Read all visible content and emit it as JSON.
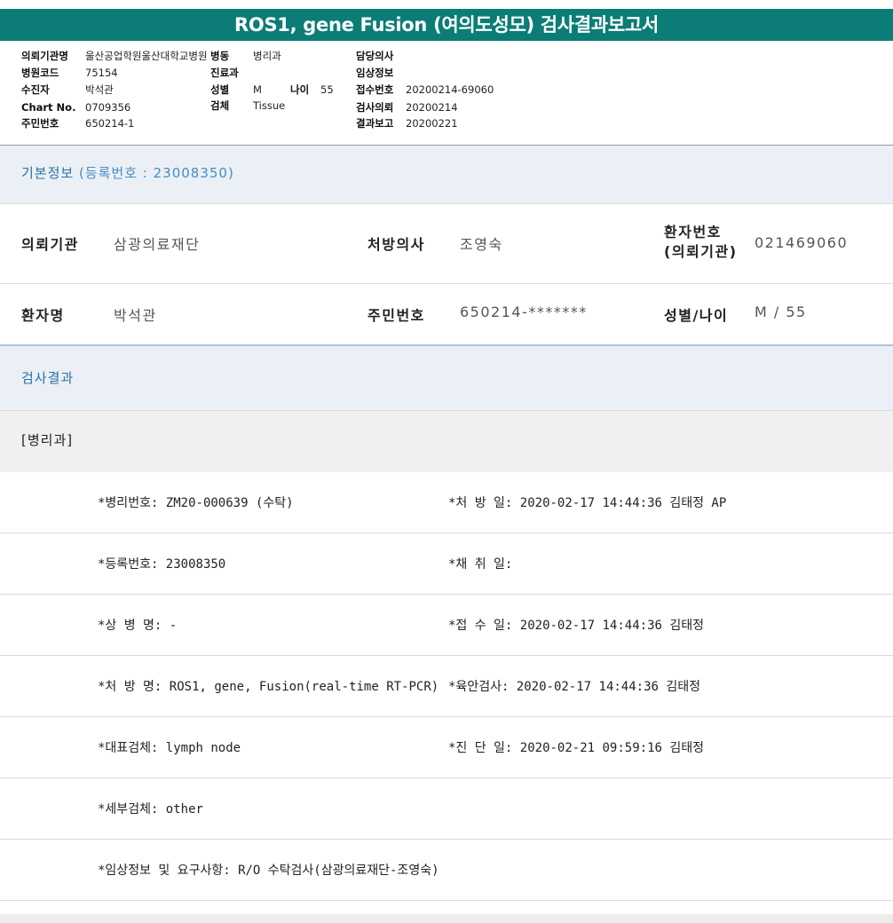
{
  "report_title": "ROS1, gene Fusion (여의도성모) 검사결과보고서",
  "meta": {
    "hospital_label": "의뢰기관명",
    "hospital_value": "울산공업학원울산대학교병원",
    "ward_label": "병동",
    "ward_value": "병리과",
    "doctor_label": "담당의사",
    "doctor_value": "",
    "hospcode_label": "병원코드",
    "hospcode_value": "75154",
    "dept_label": "진료과",
    "dept_value": "",
    "clinical_label": "임상정보",
    "clinical_value": "",
    "patient_label": "수진자",
    "patient_value": "박석관",
    "sex_label": "성별",
    "sex_value": "M",
    "age_label": "나이",
    "age_value": "55",
    "accession_label": "접수번호",
    "accession_value": "20200214-69060",
    "chart_label": "Chart No.",
    "chart_value": "0709356",
    "specimen_label": "검체",
    "specimen_value": "Tissue",
    "request_label": "검사의뢰",
    "request_value": "20200214",
    "rrn_label": "주민번호",
    "rrn_value": "650214-1",
    "report_label": "결과보고",
    "report_value": "20200221"
  },
  "basic_info": {
    "heading": "기본정보",
    "reg_no_label": "(등록번호 : 23008350)",
    "rows": [
      {
        "k1": "의뢰기관",
        "v1": "삼광의료재단",
        "k2": "처방의사",
        "v2": "조영숙",
        "k3a": "환자번호",
        "k3b": "(의뢰기관)",
        "v3": "021469060"
      },
      {
        "k1": "환자명",
        "v1": "박석관",
        "k2": "주민번호",
        "v2": "650214-*******",
        "k3a": "성별/나이",
        "k3b": "",
        "v3": "M / 55"
      }
    ]
  },
  "results": {
    "heading": "검사결과",
    "dept_band": "[병리과]",
    "rows": [
      {
        "left": "*병리번호: ZM20-000639 (수탁)",
        "right": "*처 방 일: 2020-02-17 14:44:36  김태정 AP"
      },
      {
        "left": "*등록번호: 23008350",
        "right": "*채 취 일:"
      },
      {
        "left": "*상 병 명: -",
        "right": "*접 수 일: 2020-02-17 14:44:36  김태정"
      },
      {
        "left": "*처 방 명: ROS1, gene, Fusion(real-time RT-PCR)",
        "right": "*육안검사: 2020-02-17 14:44:36  김태정"
      },
      {
        "left": "*대표검체: lymph node",
        "right": "*진 단 일: 2020-02-21 09:59:16  김태정"
      },
      {
        "left": "*세부검체: other",
        "right": ""
      },
      {
        "left": "*임상정보 및 요구사항: R/O 수탁검사(삼광의료재단-조영숙)",
        "right": ""
      }
    ]
  }
}
